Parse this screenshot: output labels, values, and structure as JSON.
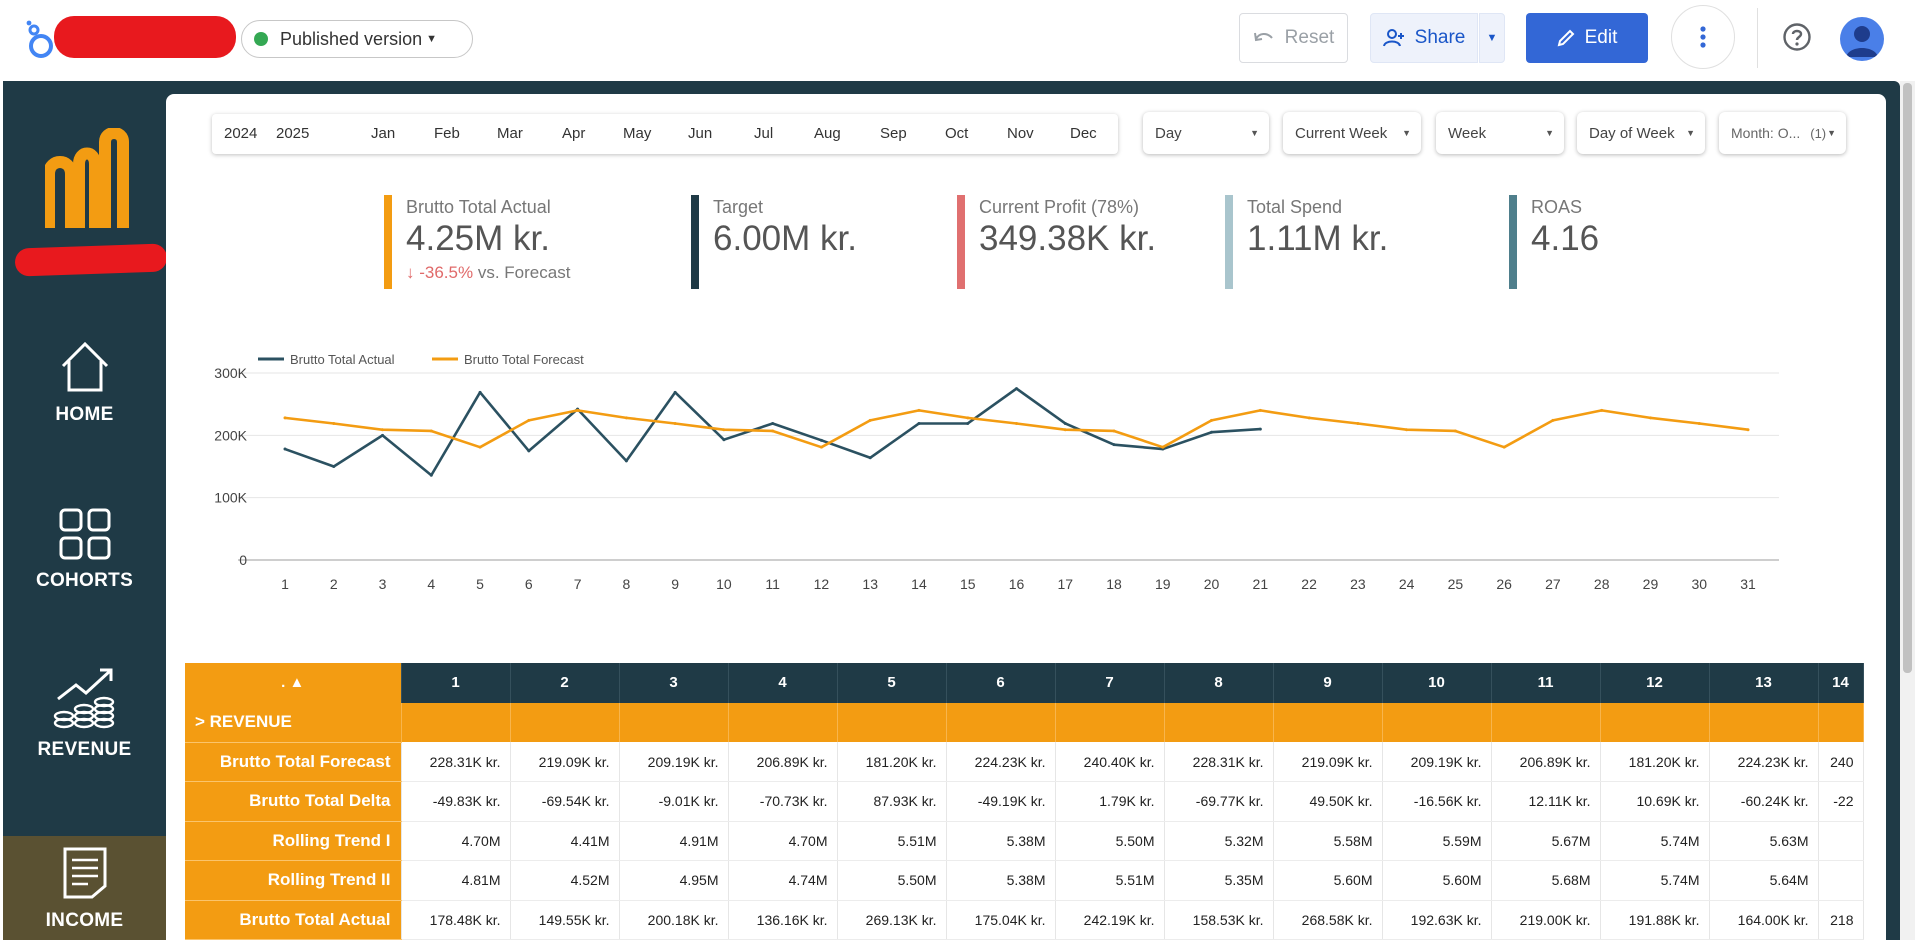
{
  "topbar": {
    "version_label": "Published version",
    "reset_label": "Reset",
    "share_label": "Share",
    "edit_label": "Edit"
  },
  "sidebar": {
    "items": [
      {
        "label": "HOME",
        "icon": "home-icon"
      },
      {
        "label": "COHORTS",
        "icon": "grid-icon"
      },
      {
        "label": "REVENUE",
        "icon": "revenue-growth-icon"
      },
      {
        "label": "INCOME",
        "icon": "document-icon"
      }
    ],
    "active": "INCOME"
  },
  "filters": {
    "years": [
      "2024",
      "2025"
    ],
    "months": [
      "Jan",
      "Feb",
      "Mar",
      "Apr",
      "May",
      "Jun",
      "Jul",
      "Aug",
      "Sep",
      "Oct",
      "Nov",
      "Dec"
    ],
    "granularity": "Day",
    "period": "Current Week",
    "week": "Week",
    "day_of_week": "Day of Week",
    "month_filter": "Month: O...",
    "month_filter_count": "(1)"
  },
  "kpis": [
    {
      "title": "Brutto Total Actual",
      "value": "4.25M kr.",
      "delta": "-36.5%",
      "delta_suffix": "vs. Forecast",
      "color": "#f39c12"
    },
    {
      "title": "Target",
      "value": "6.00M kr.",
      "color": "#1f3a46"
    },
    {
      "title": "Current Profit (78%)",
      "value": "349.38K kr.",
      "color": "#e07070"
    },
    {
      "title": "Total Spend",
      "value": "1.11M kr.",
      "color": "#a9c5cd"
    },
    {
      "title": "ROAS",
      "value": "4.16",
      "color": "#4f7f8c"
    }
  ],
  "chart_data": {
    "type": "line",
    "x": [
      1,
      2,
      3,
      4,
      5,
      6,
      7,
      8,
      9,
      10,
      11,
      12,
      13,
      14,
      15,
      16,
      17,
      18,
      19,
      20,
      21,
      22,
      23,
      24,
      25,
      26,
      27,
      28,
      29,
      30,
      31
    ],
    "series": [
      {
        "name": "Brutto Total Actual",
        "color": "#2b5161",
        "values": [
          178,
          150,
          200,
          136,
          269,
          175,
          242,
          159,
          269,
          193,
          219,
          192,
          164,
          219,
          219,
          275,
          219,
          185,
          178,
          205,
          210
        ]
      },
      {
        "name": "Brutto Total Forecast",
        "color": "#f39c12",
        "values": [
          228,
          219,
          209,
          207,
          181,
          224,
          240,
          228,
          219,
          209,
          207,
          181,
          224,
          240,
          228,
          219,
          209,
          207,
          181,
          224,
          240,
          228,
          219,
          209,
          207,
          181,
          224,
          240,
          228,
          219,
          209
        ]
      }
    ],
    "yticks": [
      "300K",
      "200K",
      "100K",
      "0"
    ],
    "ylim": [
      0,
      300
    ],
    "legend_position": "top-left",
    "grid": true
  },
  "table": {
    "corner_label": ". ▲",
    "columns": [
      "1",
      "2",
      "3",
      "4",
      "5",
      "6",
      "7",
      "8",
      "9",
      "10",
      "11",
      "12",
      "13",
      "14"
    ],
    "section_label": "> REVENUE",
    "rows": [
      {
        "label": "Brutto Total Forecast",
        "values": [
          "228.31K kr.",
          "219.09K kr.",
          "209.19K kr.",
          "206.89K kr.",
          "181.20K kr.",
          "224.23K kr.",
          "240.40K kr.",
          "228.31K kr.",
          "219.09K kr.",
          "209.19K kr.",
          "206.89K kr.",
          "181.20K kr.",
          "224.23K kr.",
          "240"
        ]
      },
      {
        "label": "Brutto Total Delta",
        "values": [
          "-49.83K kr.",
          "-69.54K kr.",
          "-9.01K kr.",
          "-70.73K kr.",
          "87.93K kr.",
          "-49.19K kr.",
          "1.79K kr.",
          "-69.77K kr.",
          "49.50K kr.",
          "-16.56K kr.",
          "12.11K kr.",
          "10.69K kr.",
          "-60.24K kr.",
          "-22"
        ]
      },
      {
        "label": "Rolling Trend I",
        "values": [
          "4.70M",
          "4.41M",
          "4.91M",
          "4.70M",
          "5.51M",
          "5.38M",
          "5.50M",
          "5.32M",
          "5.58M",
          "5.59M",
          "5.67M",
          "5.74M",
          "5.63M",
          ""
        ]
      },
      {
        "label": "Rolling Trend II",
        "values": [
          "4.81M",
          "4.52M",
          "4.95M",
          "4.74M",
          "5.50M",
          "5.38M",
          "5.51M",
          "5.35M",
          "5.60M",
          "5.60M",
          "5.68M",
          "5.74M",
          "5.64M",
          ""
        ]
      },
      {
        "label": "Brutto Total Actual",
        "values": [
          "178.48K kr.",
          "149.55K kr.",
          "200.18K kr.",
          "136.16K kr.",
          "269.13K kr.",
          "175.04K kr.",
          "242.19K kr.",
          "158.53K kr.",
          "268.58K kr.",
          "192.63K kr.",
          "219.00K kr.",
          "191.88K kr.",
          "164.00K kr.",
          "218"
        ]
      }
    ]
  }
}
